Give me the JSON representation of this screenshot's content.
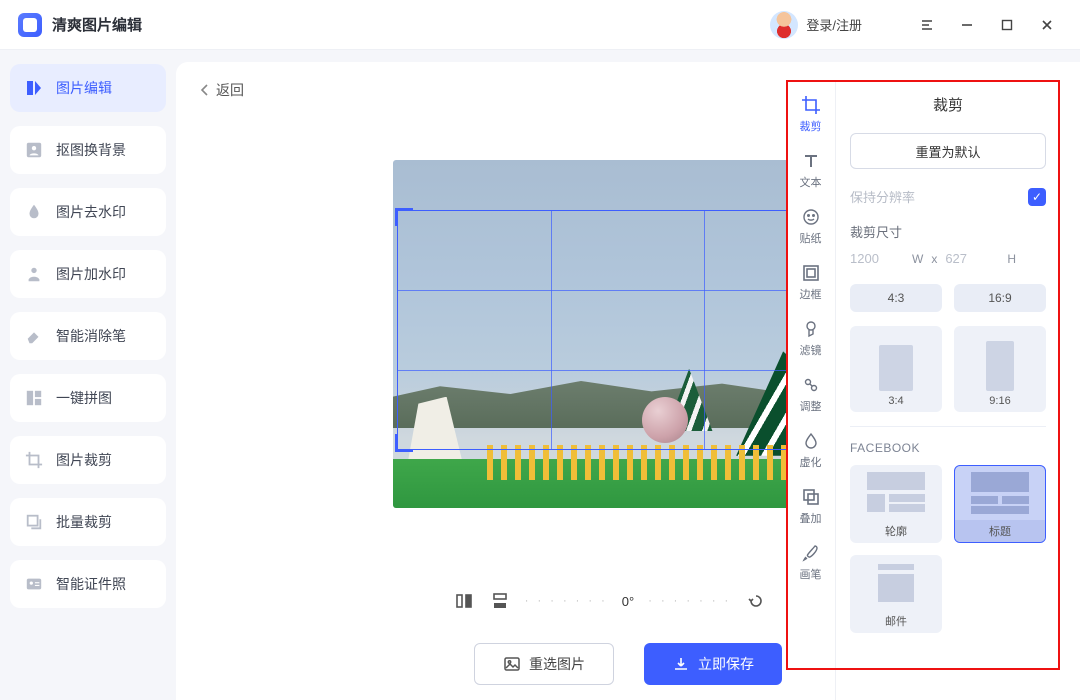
{
  "app": {
    "title": "清爽图片编辑"
  },
  "titlebar": {
    "login": "登录/注册"
  },
  "sidebar": [
    {
      "label": "图片编辑",
      "active": true
    },
    {
      "label": "抠图换背景"
    },
    {
      "label": "图片去水印"
    },
    {
      "label": "图片加水印"
    },
    {
      "label": "智能消除笔"
    },
    {
      "label": "一键拼图"
    },
    {
      "label": "图片裁剪"
    },
    {
      "label": "批量裁剪"
    },
    {
      "label": "智能证件照"
    }
  ],
  "main": {
    "back": "返回",
    "angle": "0°",
    "reselect": "重选图片",
    "save": "立即保存"
  },
  "tools": [
    {
      "key": "crop",
      "label": "裁剪",
      "active": true
    },
    {
      "key": "text",
      "label": "文本"
    },
    {
      "key": "sticker",
      "label": "贴纸"
    },
    {
      "key": "border",
      "label": "边框"
    },
    {
      "key": "filter",
      "label": "滤镜"
    },
    {
      "key": "adjust",
      "label": "调整"
    },
    {
      "key": "blur",
      "label": "虚化"
    },
    {
      "key": "overlay",
      "label": "叠加"
    },
    {
      "key": "brush",
      "label": "画笔"
    }
  ],
  "panel": {
    "title": "裁剪",
    "reset": "重置为默认",
    "keep_res": "保持分辨率",
    "size_label": "裁剪尺寸",
    "w_val": "1200",
    "w_lbl": "W",
    "x_lbl": "x",
    "h_val": "627",
    "h_lbl": "H",
    "ratios": {
      "a": "4:3",
      "b": "16:9",
      "c": "3:4",
      "d": "9:16"
    },
    "brand": "FACEBOOK",
    "fb": {
      "profile": "轮廓",
      "header": "标题",
      "mail": "邮件"
    }
  }
}
